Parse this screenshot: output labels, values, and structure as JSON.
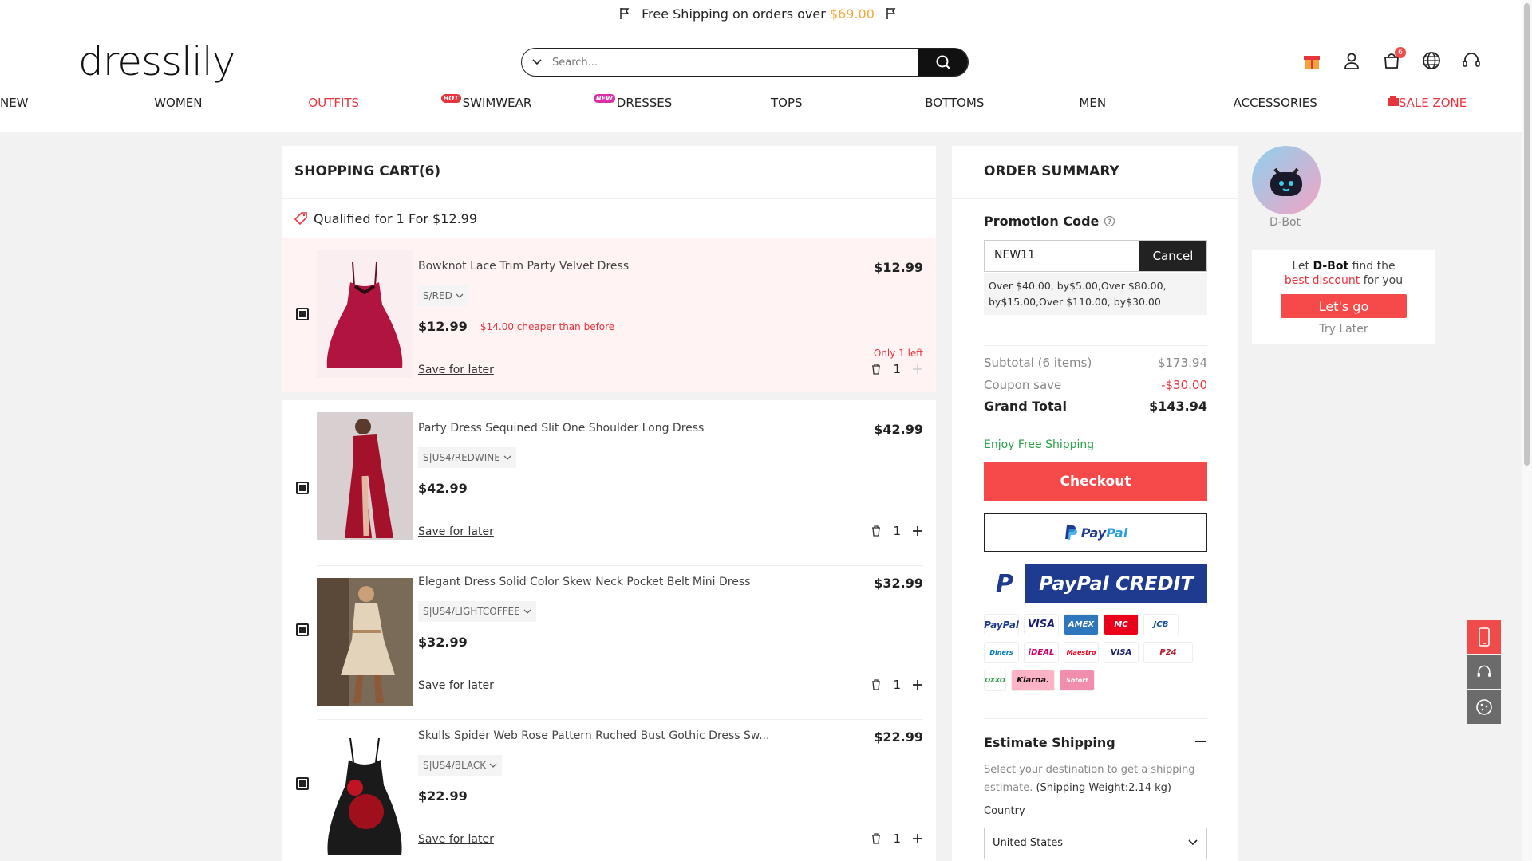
{
  "promo_bar": {
    "text": "Free Shipping on orders over ",
    "amount": "$69.00"
  },
  "logo": "dresslily",
  "search": {
    "placeholder": "Search..."
  },
  "header": {
    "cart_count": "6"
  },
  "nav": [
    {
      "label": "NEW",
      "color": "#222222",
      "tag": ""
    },
    {
      "label": "WOMEN",
      "color": "#222222",
      "tag": ""
    },
    {
      "label": "OUTFITS",
      "color": "#e8343d",
      "tag": "HOT"
    },
    {
      "label": "SWIMWEAR",
      "color": "#222222",
      "tag": "NEW"
    },
    {
      "label": "DRESSES",
      "color": "#222222",
      "tag": ""
    },
    {
      "label": "TOPS",
      "color": "#222222",
      "tag": ""
    },
    {
      "label": "BOTTOMS",
      "color": "#222222",
      "tag": ""
    },
    {
      "label": "MEN",
      "color": "#222222",
      "tag": ""
    },
    {
      "label": "ACCESSORIES",
      "color": "#222222",
      "tag": ""
    },
    {
      "label": "SALE ZONE",
      "color": "#e8343d",
      "tag": ""
    }
  ],
  "cart": {
    "title": "SHOPPING CART(6)",
    "qualified": "Qualified for 1 For $12.99",
    "items": [
      {
        "name": "Bowknot Lace Trim Party Velvet Dress",
        "price": "$12.99",
        "variant": "S/RED",
        "cheaper": "$14.00 cheaper than before",
        "stock": "Only 1 left",
        "save": "Save for later",
        "qty": "1"
      },
      {
        "name": "Party Dress Sequined Slit One Shoulder Long Dress",
        "price": "$42.99",
        "variant": "S|US4/REDWINE",
        "cheaper": "",
        "stock": "",
        "save": "Save for later",
        "qty": "1"
      },
      {
        "name": "Elegant Dress Solid Color Skew Neck Pocket Belt Mini Dress",
        "price": "$32.99",
        "variant": "S|US4/LIGHTCOFFEE",
        "cheaper": "",
        "stock": "",
        "save": "Save for later",
        "qty": "1"
      },
      {
        "name": "Skulls Spider Web Rose Pattern Ruched Bust Gothic Dress Sw...",
        "price": "$22.99",
        "variant": "S|US4/BLACK",
        "cheaper": "",
        "stock": "",
        "save": "Save for later",
        "qty": "1"
      }
    ]
  },
  "summary": {
    "title": "ORDER SUMMARY",
    "promo_label": "Promotion Code",
    "promo_code": "NEW11",
    "cancel": "Cancel",
    "promo_info": "Over $40.00, by$5.00,Over $80.00, by$15.00,Over $110.00, by$30.00",
    "subtotal_label": "Subtotal (6 items)",
    "subtotal": "$173.94",
    "coupon_label": "Coupon save",
    "coupon": "-$30.00",
    "grand_label": "Grand Total",
    "grand": "$143.94",
    "free_shipping": "Enjoy Free Shipping",
    "checkout": "Checkout",
    "paypal_a": "Pay",
    "paypal_b": "Pal",
    "paypal_credit": "PayPal CREDIT",
    "cards": [
      "PayPal",
      "VISA",
      "AMEX",
      "MC",
      "JCB",
      "Diners",
      "iDEAL",
      "Maestro",
      "VISA",
      "P24",
      "OXXO",
      "Klarna.",
      "Sofort"
    ],
    "estimate_title": "Estimate Shipping",
    "estimate_desc": "Select your destination to get a shipping estimate.",
    "weight": "(Shipping Weight:2.14 kg)",
    "country_label": "Country",
    "country": "United States"
  },
  "dbot": {
    "name": "D-Bot",
    "line1_pre": "Let ",
    "line1_bold": "D-Bot",
    "line1_post": " find the",
    "line2_red": "best discount",
    "line2_post": " for you",
    "go": "Let's go",
    "later": "Try Later"
  }
}
